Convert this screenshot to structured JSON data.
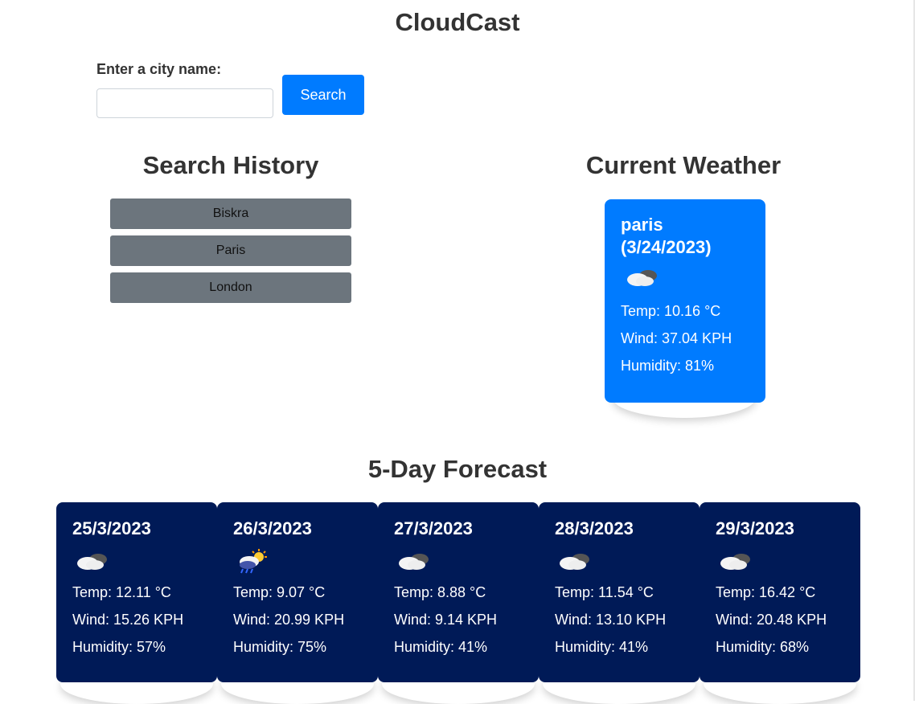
{
  "app": {
    "title": "CloudCast"
  },
  "search": {
    "label": "Enter a city name:",
    "value": "",
    "placeholder": "",
    "button_label": "Search"
  },
  "history": {
    "heading": "Search History",
    "items": [
      {
        "label": "Biskra"
      },
      {
        "label": "Paris"
      },
      {
        "label": "London"
      }
    ]
  },
  "current": {
    "heading": "Current Weather",
    "city_line": "paris",
    "date_line": "(3/24/2023)",
    "icon": "partly-cloudy-icon",
    "temp": "Temp: 10.16 °C",
    "wind": "Wind: 37.04 KPH",
    "humidity": "Humidity: 81%"
  },
  "forecast": {
    "heading": "5-Day Forecast",
    "days": [
      {
        "date": "25/3/2023",
        "icon": "cloudy-icon",
        "temp": "Temp: 12.11 °C",
        "wind": "Wind: 15.26 KPH",
        "humidity": "Humidity: 57%"
      },
      {
        "date": "26/3/2023",
        "icon": "rain-sun-icon",
        "temp": "Temp: 9.07 °C",
        "wind": "Wind: 20.99 KPH",
        "humidity": "Humidity: 75%"
      },
      {
        "date": "27/3/2023",
        "icon": "cloudy-icon",
        "temp": "Temp: 8.88 °C",
        "wind": "Wind: 9.14 KPH",
        "humidity": "Humidity: 41%"
      },
      {
        "date": "28/3/2023",
        "icon": "cloudy-icon",
        "temp": "Temp: 11.54 °C",
        "wind": "Wind: 13.10 KPH",
        "humidity": "Humidity: 41%"
      },
      {
        "date": "29/3/2023",
        "icon": "cloudy-icon",
        "temp": "Temp: 16.42 °C",
        "wind": "Wind: 20.48 KPH",
        "humidity": "Humidity: 68%"
      }
    ]
  },
  "colors": {
    "accent": "#007bff",
    "history_button": "#6c757d",
    "forecast_card": "#001a57"
  }
}
